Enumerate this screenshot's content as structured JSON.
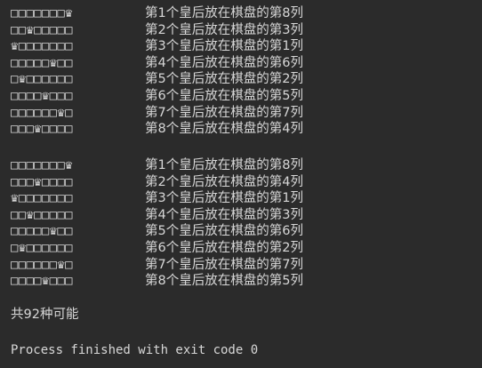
{
  "solutions": [
    {
      "rows": [
        {
          "board": "□□□□□□□♛",
          "text": "第1个皇后放在棋盘的第8列"
        },
        {
          "board": "□□♛□□□□□",
          "text": "第2个皇后放在棋盘的第3列"
        },
        {
          "board": "♛□□□□□□□",
          "text": "第3个皇后放在棋盘的第1列"
        },
        {
          "board": "□□□□□♛□□",
          "text": "第4个皇后放在棋盘的第6列"
        },
        {
          "board": "□♛□□□□□□",
          "text": "第5个皇后放在棋盘的第2列"
        },
        {
          "board": "□□□□♛□□□",
          "text": "第6个皇后放在棋盘的第5列"
        },
        {
          "board": "□□□□□□♛□",
          "text": "第7个皇后放在棋盘的第7列"
        },
        {
          "board": "□□□♛□□□□",
          "text": "第8个皇后放在棋盘的第4列"
        }
      ]
    },
    {
      "rows": [
        {
          "board": "□□□□□□□♛",
          "text": "第1个皇后放在棋盘的第8列"
        },
        {
          "board": "□□□♛□□□□",
          "text": "第2个皇后放在棋盘的第4列"
        },
        {
          "board": "♛□□□□□□□",
          "text": "第3个皇后放在棋盘的第1列"
        },
        {
          "board": "□□♛□□□□□",
          "text": "第4个皇后放在棋盘的第3列"
        },
        {
          "board": "□□□□□♛□□",
          "text": "第5个皇后放在棋盘的第6列"
        },
        {
          "board": "□♛□□□□□□",
          "text": "第6个皇后放在棋盘的第2列"
        },
        {
          "board": "□□□□□□♛□",
          "text": "第7个皇后放在棋盘的第7列"
        },
        {
          "board": "□□□□♛□□□",
          "text": "第8个皇后放在棋盘的第5列"
        }
      ]
    }
  ],
  "summary": "共92种可能",
  "process_message": "Process finished with exit code 0",
  "colors": {
    "background": "#2b2b2b",
    "text": "#d7d7d7"
  }
}
